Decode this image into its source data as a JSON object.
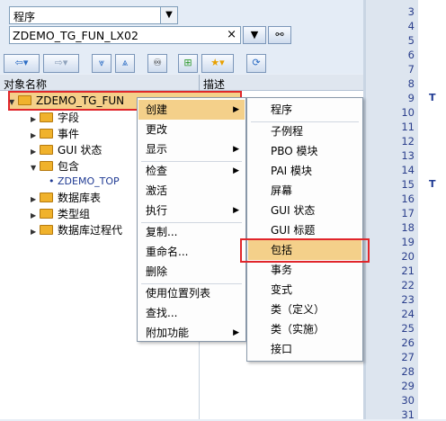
{
  "object_type": {
    "value": "程序"
  },
  "object_name": {
    "value": "ZDEMO_TG_FUN_LX02"
  },
  "tree": {
    "columns": {
      "name": "对象名称",
      "description": "描述"
    },
    "root": "ZDEMO_TG_FUN",
    "nodes": [
      "字段",
      "事件",
      "GUI 状态",
      "包含",
      "ZDEMO_TOP",
      "数据库表",
      "类型组",
      "数据库过程代"
    ]
  },
  "context_menu": {
    "items": [
      "创建",
      "更改",
      "显示",
      "检查",
      "激活",
      "执行",
      "复制...",
      "重命名...",
      "删除",
      "使用位置列表",
      "查找...",
      "附加功能"
    ]
  },
  "create_submenu": {
    "items": [
      "程序",
      "子例程",
      "PBO 模块",
      "PAI 模块",
      "屏幕",
      "GUI 状态",
      "GUI 标题",
      "包括",
      "事务",
      "变式",
      "类（定义）",
      "类（实施）",
      "接口"
    ]
  },
  "code": {
    "line_numbers": [
      "3",
      "4",
      "5",
      "6",
      "7",
      "8",
      "9",
      "10",
      "11",
      "12",
      "13",
      "14",
      "15",
      "16",
      "17",
      "18",
      "19",
      "20",
      "21",
      "22",
      "23",
      "24",
      "25",
      "26",
      "27",
      "28",
      "29",
      "30",
      "31"
    ],
    "fragments": [
      "T",
      "T"
    ]
  }
}
